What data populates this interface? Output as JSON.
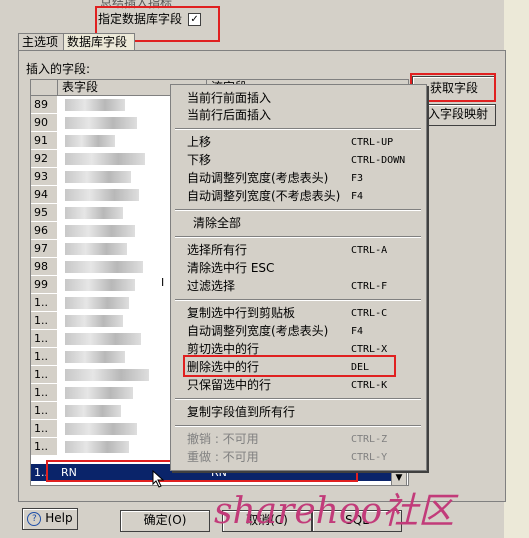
{
  "top": {
    "clipped_text": "总结插入指标",
    "specify_db_field": "指定数据库字段",
    "checkmark": "✓"
  },
  "tabs": [
    "主选项",
    "数据库字段"
  ],
  "insert_fields_label": "插入的字段:",
  "grid": {
    "col_table_field": "表字段",
    "col_stream_field": "流字段",
    "row_numbers": [
      "89",
      "90",
      "91",
      "92",
      "93",
      "94",
      "95",
      "96",
      "97",
      "98",
      "99",
      "1..",
      "1..",
      "1..",
      "1..",
      "1..",
      "1..",
      "1..",
      "1..",
      "1..",
      "1.."
    ],
    "row99_suffix": "I",
    "selected_row": {
      "num": "1..",
      "table_field": "RN",
      "stream_field": "RN"
    }
  },
  "buttons": {
    "get_fields": "获取字段",
    "map_fields": "入字段映射",
    "help": "Help",
    "ok": "确定(O)",
    "cancel": "取消(C)",
    "sql": "SQL"
  },
  "menu": [
    {
      "label": "当前行前面插入",
      "key": ""
    },
    {
      "label": "当前行后面插入",
      "key": ""
    },
    {
      "label": "上移",
      "key": "CTRL-UP"
    },
    {
      "label": "下移",
      "key": "CTRL-DOWN"
    },
    {
      "label": "自动调整列宽度(考虑表头)",
      "key": "F3"
    },
    {
      "label": "自动调整列宽度(不考虑表头)",
      "key": "F4"
    },
    {
      "label": "清除全部",
      "key": ""
    },
    {
      "label": "选择所有行",
      "key": "CTRL-A"
    },
    {
      "label": "清除选中行 ESC",
      "key": ""
    },
    {
      "label": "过滤选择",
      "key": "CTRL-F"
    },
    {
      "label": "复制选中行到剪贴板",
      "key": "CTRL-C"
    },
    {
      "label": "自动调整列宽度(考虑表头)",
      "key": "F4"
    },
    {
      "label": "剪切选中的行",
      "key": "CTRL-X"
    },
    {
      "label": "删除选中的行",
      "key": "DEL"
    },
    {
      "label": "只保留选中的行",
      "key": "CTRL-K"
    },
    {
      "label": "复制字段值到所有行",
      "key": ""
    },
    {
      "label": "撤销 : 不可用",
      "key": "CTRL-Z"
    },
    {
      "label": "重做 : 不可用",
      "key": "CTRL-Y"
    }
  ],
  "watermark": "sharehoo社区",
  "colors": {
    "highlight": "#e02020",
    "selection": "#0a246a"
  }
}
